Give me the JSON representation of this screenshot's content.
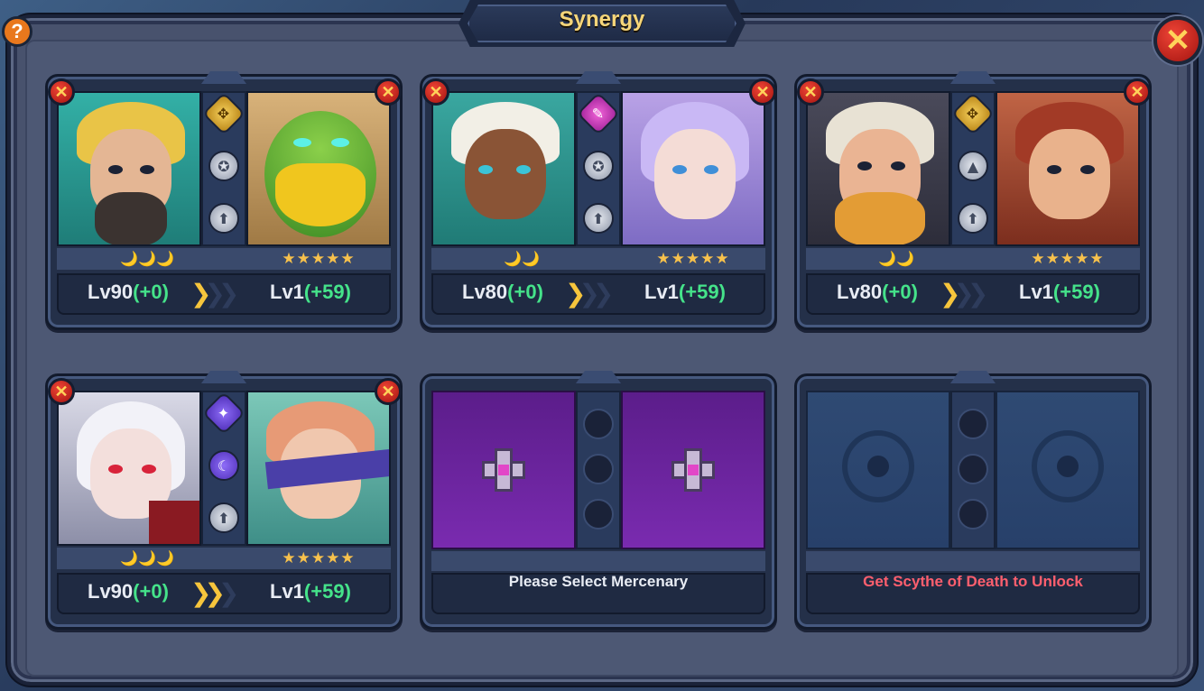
{
  "header": {
    "title": "Synergy",
    "help_label": "?",
    "close_label": "✕"
  },
  "cards": [
    {
      "left_level": "Lv90",
      "left_bonus": "(+0)",
      "right_level": "Lv1",
      "right_bonus": "(+59)",
      "moons": "🌙🌙🌙",
      "stars": "★★★★★",
      "skills": [
        "✥",
        "✪",
        "⬆"
      ]
    },
    {
      "left_level": "Lv80",
      "left_bonus": "(+0)",
      "right_level": "Lv1",
      "right_bonus": "(+59)",
      "moons": "🌙🌙",
      "stars": "★★★★★",
      "skills": [
        "✎",
        "✪",
        "⬆"
      ]
    },
    {
      "left_level": "Lv80",
      "left_bonus": "(+0)",
      "right_level": "Lv1",
      "right_bonus": "(+59)",
      "moons": "🌙🌙",
      "stars": "★★★★★",
      "skills": [
        "✥",
        "▲",
        "⬆"
      ]
    },
    {
      "left_level": "Lv90",
      "left_bonus": "(+0)",
      "right_level": "Lv1",
      "right_bonus": "(+59)",
      "moons": "🌙🌙🌙",
      "stars": "★★★★★",
      "skills": [
        "✦",
        "☾",
        "⬆"
      ]
    }
  ],
  "empty_slot": {
    "message": "Please Select Mercenary"
  },
  "locked_slot": {
    "message": "Get Scythe of Death to Unlock"
  },
  "colors": {
    "accent_gold": "#f6d67a",
    "bonus_green": "#45e38a",
    "locked_red": "#ff5f6e"
  },
  "icons": {
    "remove": "close-icon",
    "arrow": "chevron-right-icon"
  }
}
